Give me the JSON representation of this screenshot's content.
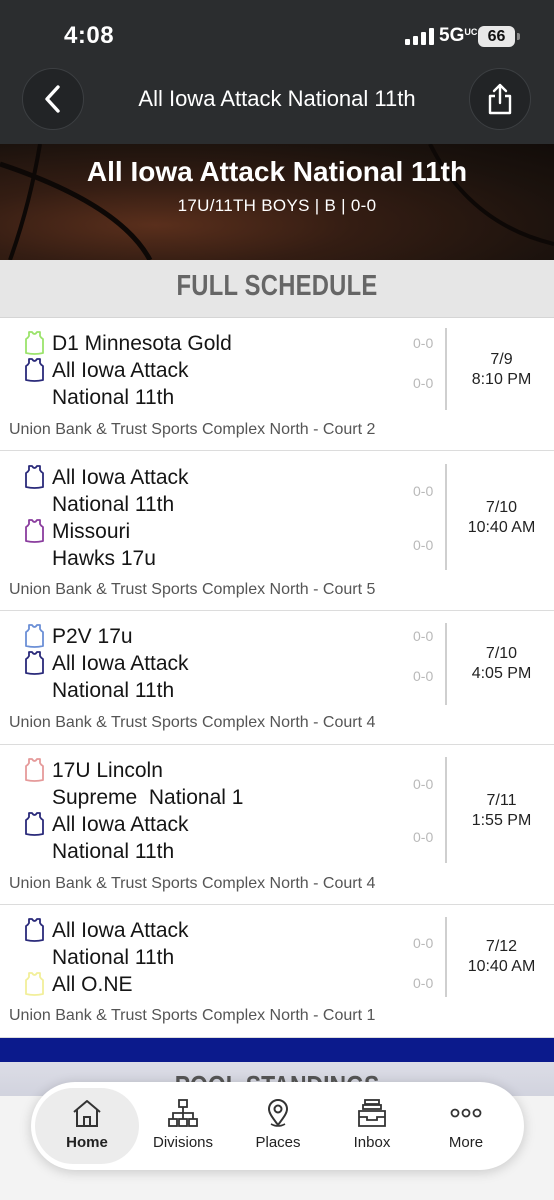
{
  "status_bar": {
    "time": "4:08",
    "network": "5G",
    "network_sup": "UC",
    "battery": "66"
  },
  "header": {
    "title": "All Iowa Attack National 11th"
  },
  "hero": {
    "title": "All Iowa Attack National 11th",
    "subtitle": "17U/11TH BOYS | B | 0-0"
  },
  "schedule": {
    "section_title": "FULL SCHEDULE",
    "games": [
      {
        "teams": [
          {
            "name": "D1 Minnesota Gold",
            "score": "0-0",
            "color": "#9be36b"
          },
          {
            "name": "All Iowa Attack\nNational 11th",
            "score": "0-0",
            "color": "#2a2a7a"
          }
        ],
        "date": "7/9",
        "time": "8:10 PM",
        "venue": "Union Bank & Trust Sports Complex North - Court 2"
      },
      {
        "teams": [
          {
            "name": "All Iowa Attack\nNational 11th",
            "score": "0-0",
            "color": "#2a2a7a"
          },
          {
            "name": "Missouri\nHawks 17u",
            "score": "0-0",
            "color": "#8a3d9e"
          }
        ],
        "date": "7/10",
        "time": "10:40 AM",
        "venue": "Union Bank & Trust Sports Complex North - Court 5"
      },
      {
        "teams": [
          {
            "name": "P2V 17u",
            "score": "0-0",
            "color": "#6b8fd6"
          },
          {
            "name": "All Iowa Attack\nNational 11th",
            "score": "0-0",
            "color": "#2a2a7a"
          }
        ],
        "date": "7/10",
        "time": "4:05 PM",
        "venue": "Union Bank & Trust Sports Complex North - Court 4"
      },
      {
        "teams": [
          {
            "name": "17U Lincoln\nSupreme  National 1",
            "score": "0-0",
            "color": "#e59a9a"
          },
          {
            "name": "All Iowa Attack\nNational 11th",
            "score": "0-0",
            "color": "#2a2a7a"
          }
        ],
        "date": "7/11",
        "time": "1:55 PM",
        "venue": "Union Bank & Trust Sports Complex North - Court 4"
      },
      {
        "teams": [
          {
            "name": "All Iowa Attack\nNational 11th",
            "score": "0-0",
            "color": "#2a2a7a"
          },
          {
            "name": "All O.NE",
            "score": "0-0",
            "color": "#f2ef9a"
          }
        ],
        "date": "7/12",
        "time": "10:40 AM",
        "venue": "Union Bank & Trust Sports Complex North - Court 1"
      }
    ]
  },
  "pool_standings": {
    "title": "POOL STANDINGS"
  },
  "tabs": [
    {
      "label": "Home",
      "icon": "home-icon",
      "active": true
    },
    {
      "label": "Divisions",
      "icon": "divisions-icon"
    },
    {
      "label": "Places",
      "icon": "location-pin-icon"
    },
    {
      "label": "Inbox",
      "icon": "inbox-icon"
    },
    {
      "label": "More",
      "icon": "more-icon"
    }
  ]
}
